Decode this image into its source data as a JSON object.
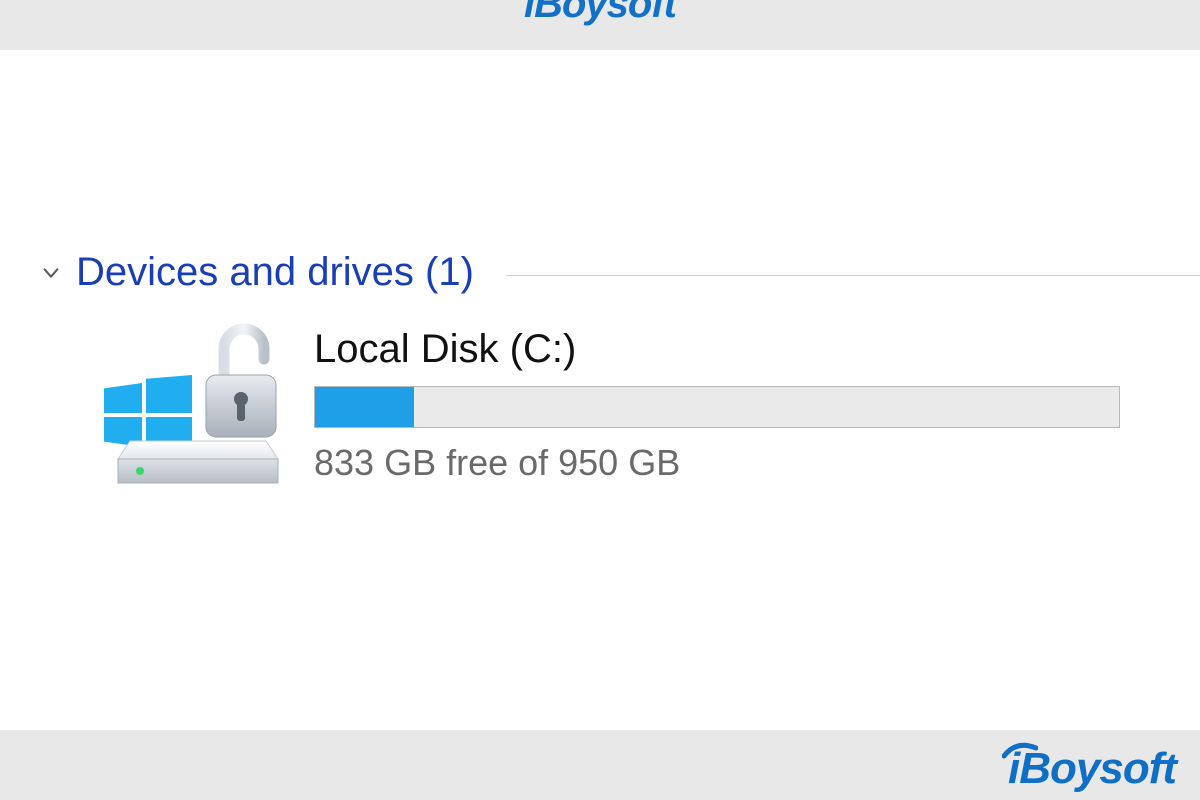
{
  "brand": {
    "name": "iBoysoft",
    "top_fragment": "iBoysoft"
  },
  "section": {
    "title": "Devices and drives (1)"
  },
  "drive": {
    "name": "Local Disk (C:)",
    "free_text": "833 GB free of 950 GB",
    "free_gb": 833,
    "total_gb": 950,
    "used_percent": 12.3,
    "bitlocker_unlocked": true
  },
  "colors": {
    "accent_blue": "#1e9fe6",
    "link_blue": "#1a3db8",
    "brand_blue": "#0f6fc6"
  }
}
